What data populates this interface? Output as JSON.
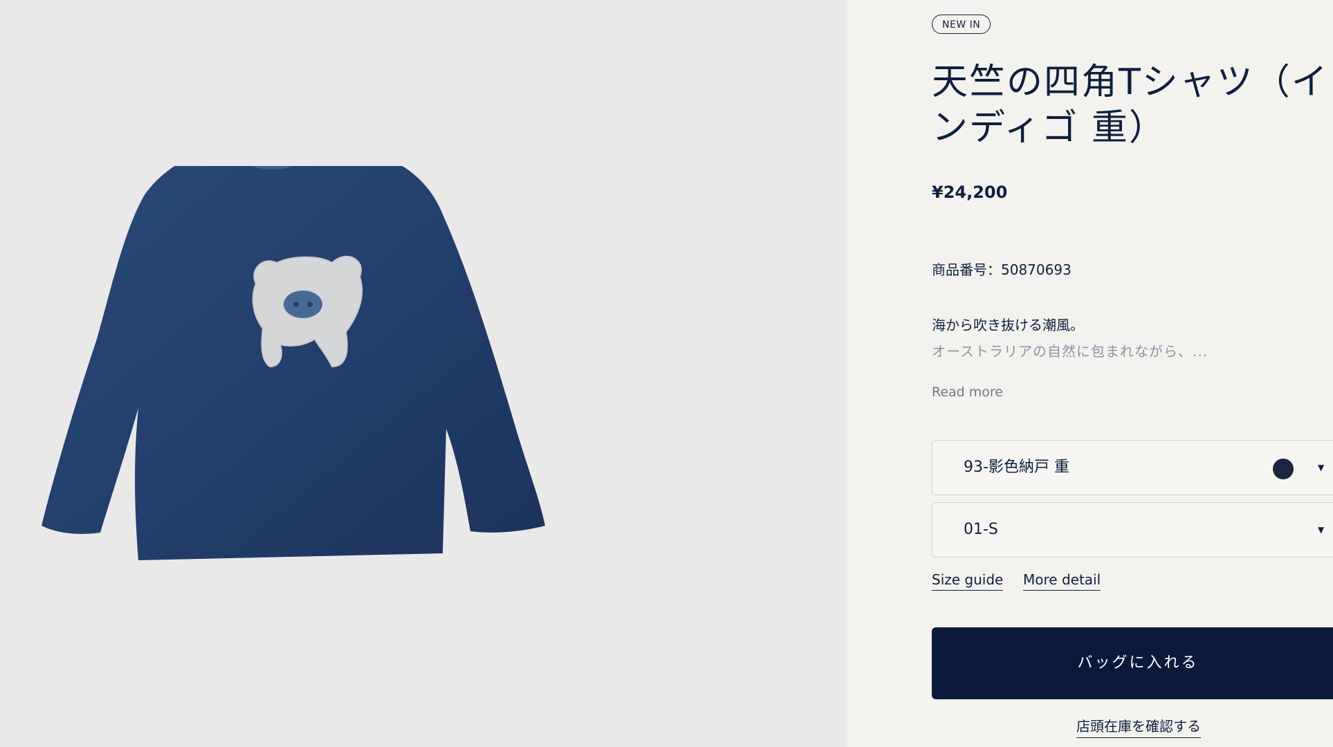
{
  "product": {
    "badge": "NEW IN",
    "title_line1": "天竺の四角Tシャツ（イ",
    "title_line2": "ンディゴ 重）",
    "price": "¥24,200",
    "sku": "商品番号：50870693",
    "description_lead": "海から吹き抜ける潮風。",
    "description_preview": "オーストラリアの自然に包まれながら、...",
    "read_more": "Read more"
  },
  "options": {
    "color_value": "93-影色納戸 重",
    "color_swatch": "#1b2540",
    "size_value": "01-S",
    "caret_icon": "▼"
  },
  "links": {
    "size_guide": "Size guide",
    "more_detail": "More detail",
    "store_stock": "店頭在庫を確認する"
  },
  "actions": {
    "add_to_bag": "バッグに入れる"
  },
  "colors": {
    "navy": "#0b1a3a",
    "image_bg": "#e9e9e9",
    "panel_bg": "#f3f2ee",
    "muted_text": "#8b92a3"
  }
}
